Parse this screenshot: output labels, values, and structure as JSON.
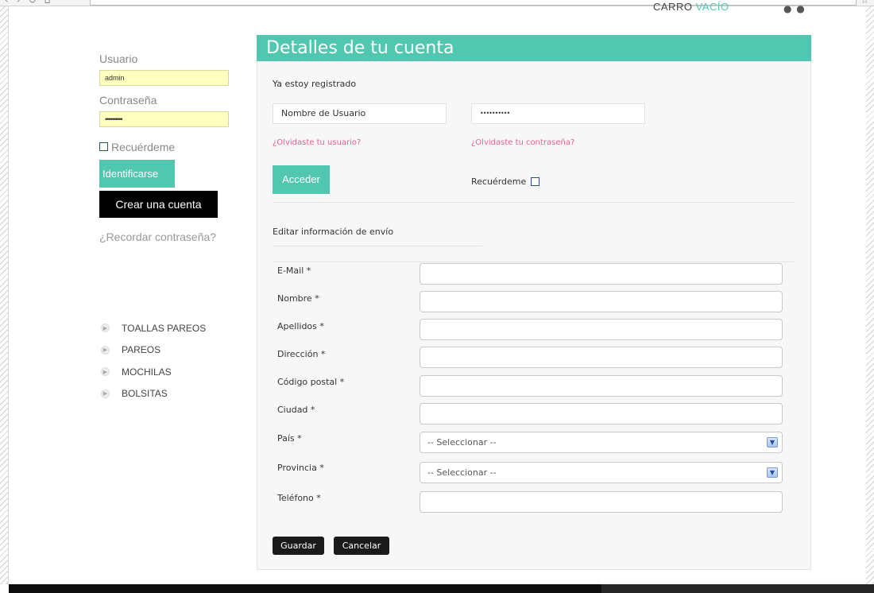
{
  "cart": {
    "label": "CARRO",
    "status": "VACÍO"
  },
  "login": {
    "username_label": "Usuario",
    "username_value": "admin",
    "password_label": "Contraseña",
    "password_value": "••••••••••",
    "remember_label": "Recuérdeme",
    "login_button": "Identificarse",
    "create_account_button": "Crear una cuenta",
    "forgot_password_link": "¿Recordar contraseña?"
  },
  "categories": [
    "TOALLAS PAREOS",
    "PAREOS",
    "MOCHILAS",
    "BOLSITAS"
  ],
  "account": {
    "title": "Detalles de tu cuenta",
    "registered_heading": "Ya estoy registrado",
    "username_placeholder": "Nombre de Usuario",
    "password_value": "••••••••••",
    "forgot_username": "¿Olvidaste tu usuario?",
    "forgot_password": "¿Olvidaste tu contraseña?",
    "access_button": "Acceder",
    "remember_label": "Recuérdeme"
  },
  "shipping": {
    "heading": "Editar información de envío",
    "fields": {
      "email": "E-Mail *",
      "name": "Nombre *",
      "surname": "Apellidos *",
      "address": "Dirección *",
      "postal_code": "Código postal *",
      "city": "Ciudad *",
      "country": "País *",
      "province": "Provincia *",
      "phone": "Teléfono *"
    },
    "select_placeholder": "-- Seleccionar --",
    "save_button": "Guardar",
    "cancel_button": "Cancelar"
  },
  "colors": {
    "accent": "#52c7b0",
    "link": "#e85f8e",
    "autofill": "#ffffc0",
    "dark": "#000000"
  }
}
